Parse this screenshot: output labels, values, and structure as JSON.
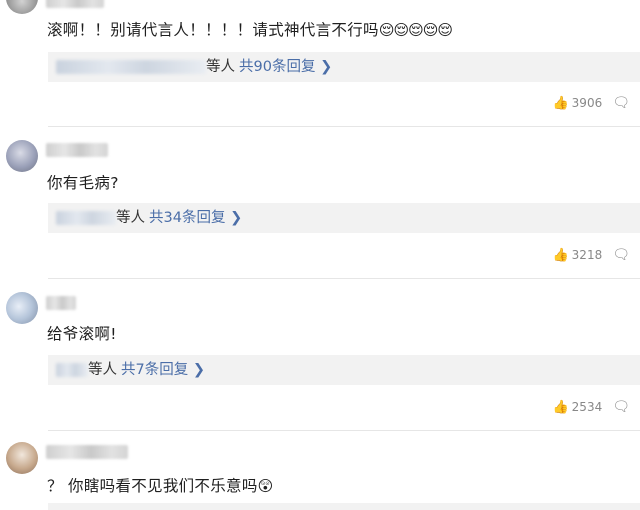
{
  "comments": [
    {
      "text": "滚啊！！别请代言人！！！！请式神代言不行吗",
      "emojis": "😌😌😌😌😌",
      "reply_suffix": "等人",
      "reply_link": "共90条回复",
      "likes": "3906"
    },
    {
      "text": "你有毛病?",
      "reply_suffix": "等人",
      "reply_link": "共34条回复",
      "likes": "3218"
    },
    {
      "text": "给爷滚啊!",
      "reply_suffix": "等人",
      "reply_link": "共7条回复",
      "likes": "2534"
    },
    {
      "text": "？ 你瞎吗看不见我们不乐意吗",
      "emojis": "😲"
    }
  ],
  "icons": {
    "like": "thumbs-up-icon",
    "reply": "comment-bubble-icon",
    "chevron": "chevron-right-icon"
  },
  "glyphs": {
    "chevron": "❯",
    "thumb": "👍",
    "bubble": "🗨"
  }
}
